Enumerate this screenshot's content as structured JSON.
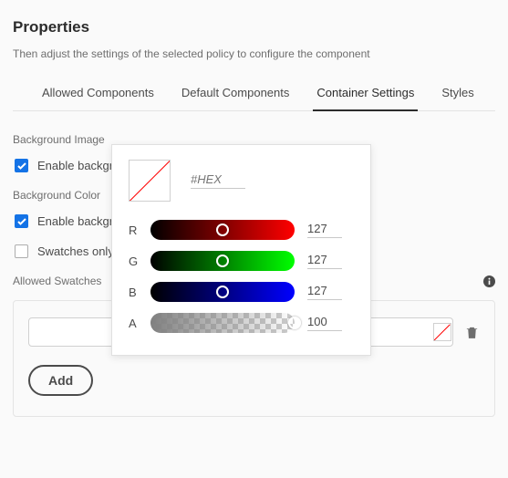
{
  "header": {
    "title": "Properties",
    "subtitle": "Then adjust the settings of the selected policy to configure the component"
  },
  "tabs": {
    "items": [
      {
        "label": "Allowed Components",
        "active": false
      },
      {
        "label": "Default Components",
        "active": false
      },
      {
        "label": "Container Settings",
        "active": true
      },
      {
        "label": "Styles",
        "active": false
      }
    ]
  },
  "background_image": {
    "section_label": "Background Image",
    "enable_label": "Enable background image",
    "enable_checked": true
  },
  "background_color": {
    "section_label": "Background Color",
    "enable_label": "Enable background color",
    "enable_checked": true,
    "swatches_only_label": "Swatches only",
    "swatches_only_checked": false
  },
  "allowed_swatches": {
    "section_label": "Allowed Swatches",
    "add_label": "Add"
  },
  "color_picker": {
    "hex_placeholder": "#HEX",
    "channels": {
      "r": {
        "label": "R",
        "value": "127"
      },
      "g": {
        "label": "G",
        "value": "127"
      },
      "b": {
        "label": "B",
        "value": "127"
      },
      "a": {
        "label": "A",
        "value": "100"
      }
    }
  }
}
